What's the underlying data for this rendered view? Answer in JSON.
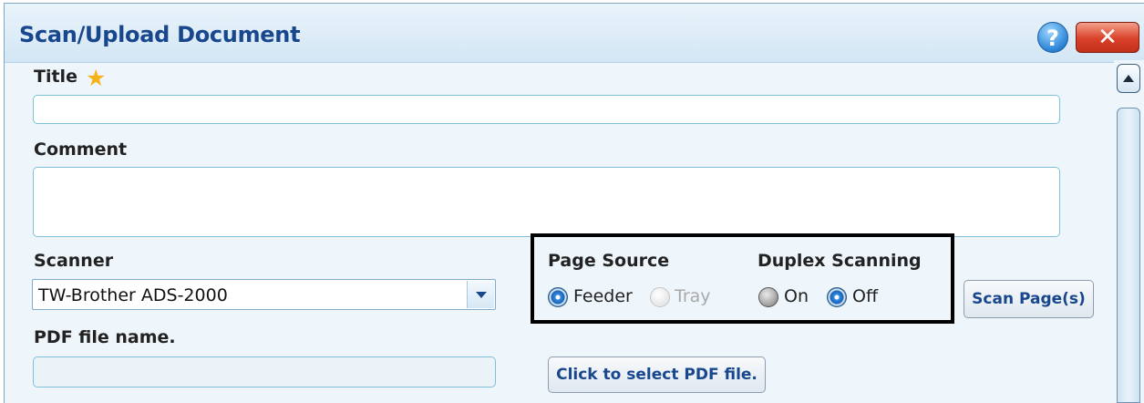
{
  "dialog": {
    "title": "Scan/Upload Document",
    "help_icon": "?",
    "close_icon": "✕"
  },
  "form": {
    "title_label": "Title",
    "title_value": "",
    "comment_label": "Comment",
    "comment_value": "",
    "scanner_label": "Scanner",
    "scanner_selected": "TW-Brother ADS-2000",
    "pdf_label": "PDF file name.",
    "pdf_value": "",
    "select_pdf_button": "Click to select PDF file.",
    "scan_button": "Scan Page(s)"
  },
  "page_source": {
    "label": "Page Source",
    "options": [
      {
        "label": "Feeder",
        "state": "selected"
      },
      {
        "label": "Tray",
        "state": "disabled"
      }
    ]
  },
  "duplex": {
    "label": "Duplex Scanning",
    "options": [
      {
        "label": "On",
        "state": "unselected"
      },
      {
        "label": "Off",
        "state": "selected"
      }
    ]
  },
  "colors": {
    "title_text": "#18478d",
    "highlight_border": "#000000",
    "close_red": "#d9412a"
  }
}
